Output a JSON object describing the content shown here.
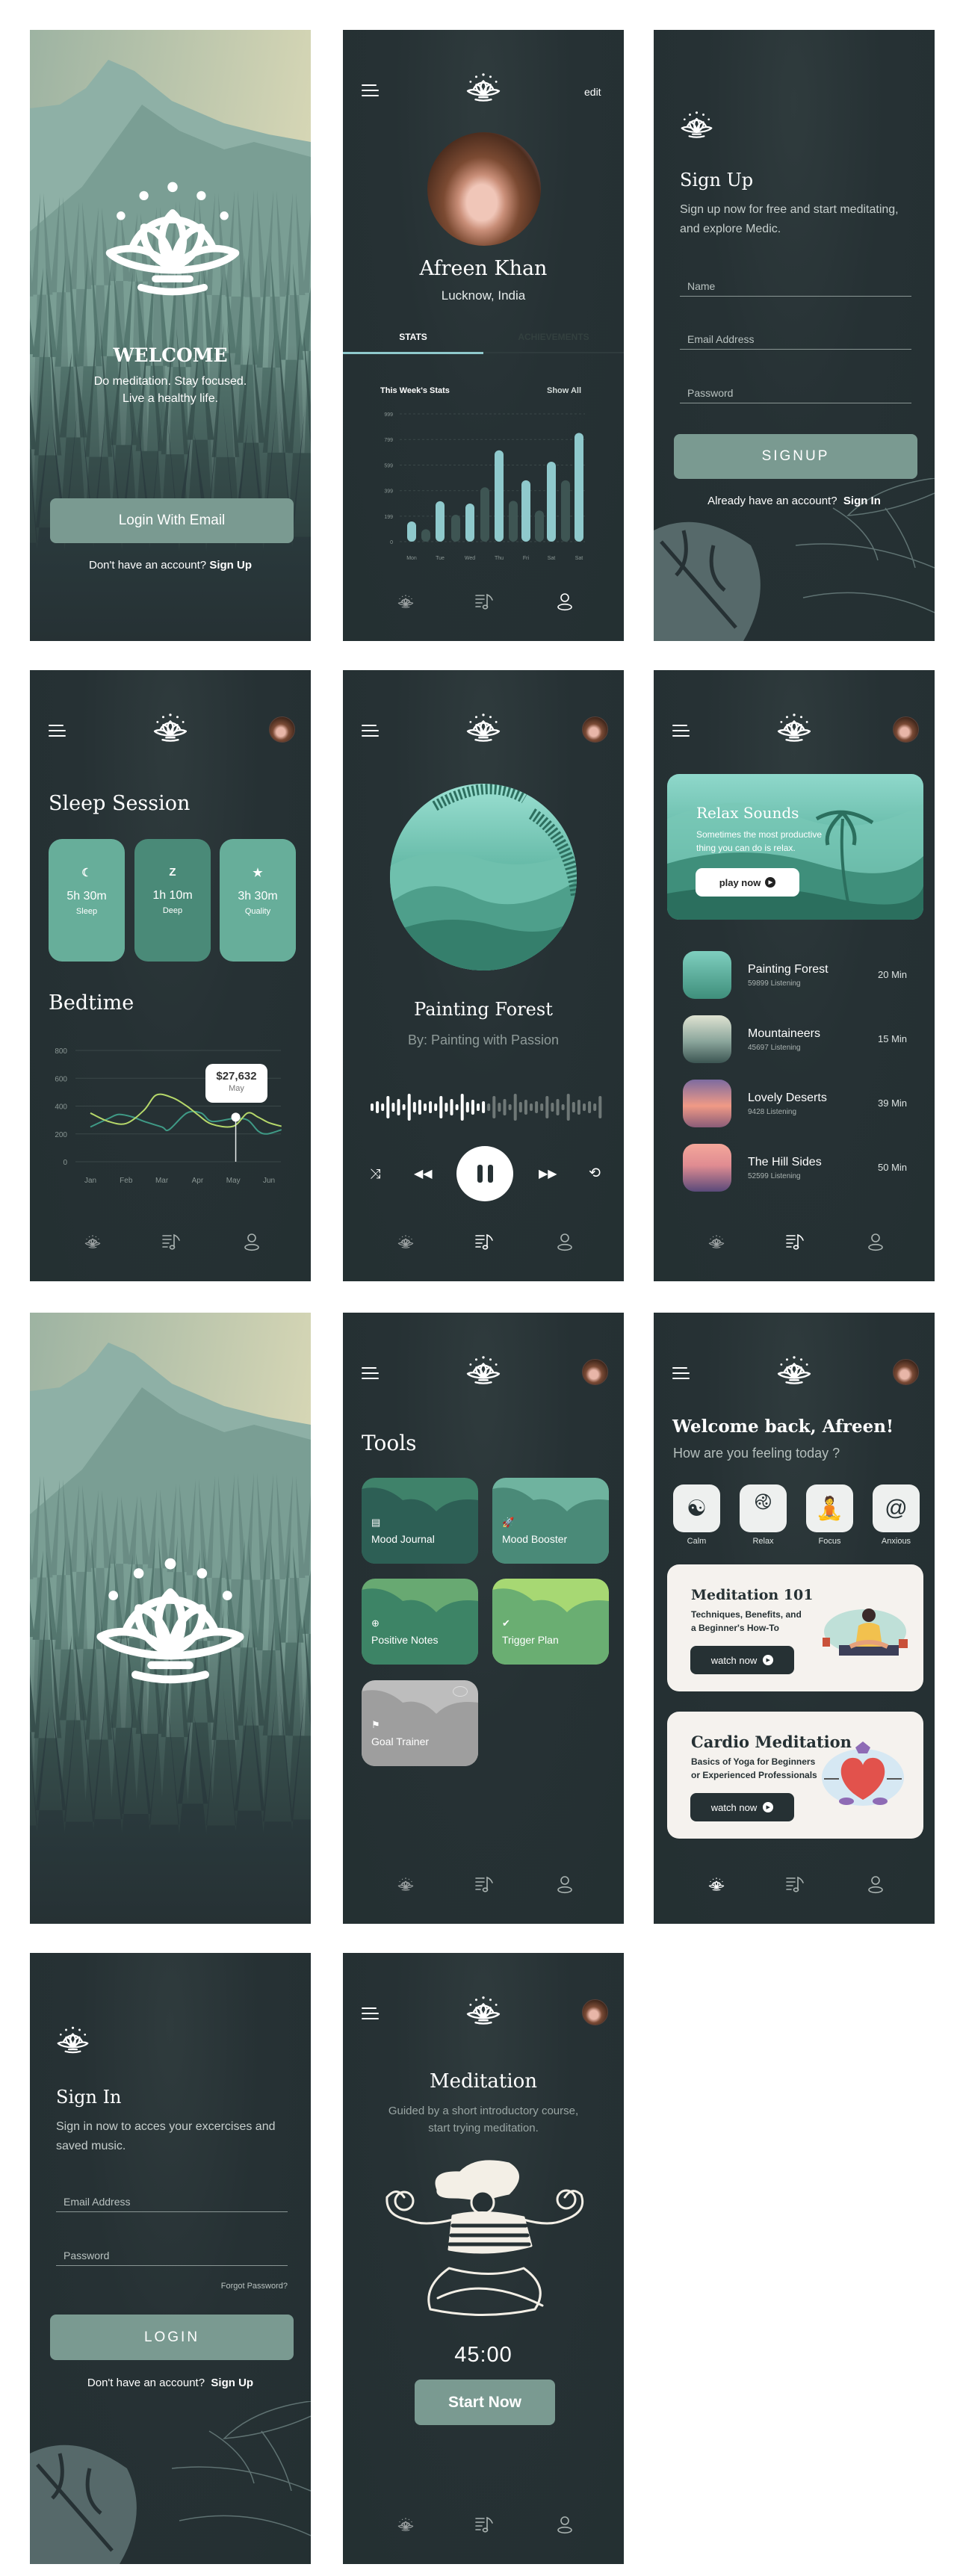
{
  "colors": {
    "background": "#263134",
    "accent_button": "#7a9a91",
    "tab_active": "#8fc9cc",
    "card_light": "#67ae9a",
    "card_dark": "#4a8a78",
    "line_yellow": "#b6d86a",
    "line_teal": "#3f9a86",
    "cream_card": "#f5f2ee"
  },
  "icons": {
    "menu": "hamburger-icon",
    "logo": "lotus-logo-icon",
    "nav": [
      "lotus-icon",
      "music-list-icon",
      "user-icon"
    ]
  },
  "welcome": {
    "title": "WELCOME",
    "subtitle_line1": "Do meditation. Stay focused.",
    "subtitle_line2": "Live a healthy life.",
    "login_button": "Login With Email",
    "no_account": "Don't have an account?",
    "sign_up_link": "Sign Up"
  },
  "profile": {
    "edit": "edit",
    "name": "Afreen Khan",
    "location": "Lucknow, India",
    "tabs": [
      "STATS",
      "ACHIEVEMENTS"
    ],
    "active_tab": "STATS",
    "stats_title": "This Week's Stats",
    "show_all": "Show All"
  },
  "signup": {
    "title": "Sign Up",
    "description": "Sign up now for free and start meditating, and explore Medic.",
    "fields": [
      "Name",
      "Email Address",
      "Password"
    ],
    "button": "SIGNUP",
    "have_account": "Already have an account?",
    "sign_in_link": "Sign In"
  },
  "sleep": {
    "title": "Sleep Session",
    "cards": [
      {
        "icon": "moon-icon",
        "glyph": "☾",
        "value": "5h 30m",
        "label": "Sleep"
      },
      {
        "icon": "z-icon",
        "glyph": "Z",
        "value": "1h 10m",
        "label": "Deep"
      },
      {
        "icon": "star-icon",
        "glyph": "★",
        "value": "3h 30m",
        "label": "Quality"
      }
    ],
    "bedtime_title": "Bedtime",
    "tooltip_value": "$27,632",
    "tooltip_label": "May"
  },
  "player": {
    "title": "Painting Forest",
    "artist": "By: Painting with Passion",
    "progress": 0.48,
    "controls": [
      "shuffle",
      "previous",
      "pause",
      "next",
      "repeat"
    ]
  },
  "relax": {
    "banner_title": "Relax Sounds",
    "banner_text_line1": "Sometimes the most productive",
    "banner_text_line2": "thing you can do is relax.",
    "play_button": "play now",
    "tracks": [
      {
        "title": "Painting Forest",
        "listeners": "59899 Listening",
        "duration": "20 Min"
      },
      {
        "title": "Mountaineers",
        "listeners": "45697 Listening",
        "duration": "15 Min"
      },
      {
        "title": "Lovely Deserts",
        "listeners": "9428  Listening",
        "duration": "39 Min"
      },
      {
        "title": "The Hill Sides",
        "listeners": "52599 Listening",
        "duration": "50 Min"
      }
    ]
  },
  "tools": {
    "title": "Tools",
    "items": [
      {
        "label": "Mood Journal",
        "icon": "journal-icon"
      },
      {
        "label": "Mood Booster",
        "icon": "rocket-icon"
      },
      {
        "label": "Positive Notes",
        "icon": "head-plus-icon"
      },
      {
        "label": "Trigger Plan",
        "icon": "badge-check-icon"
      },
      {
        "label": "Goal Trainer",
        "icon": "flag-icon",
        "locked": true
      }
    ]
  },
  "home": {
    "greeting": "Welcome back, Afreen!",
    "question": "How are you feeling today ?",
    "moods": [
      {
        "label": "Calm",
        "icon": "yin-yang-icon"
      },
      {
        "label": "Relax",
        "icon": "triskelion-icon"
      },
      {
        "label": "Focus",
        "icon": "buddha-icon"
      },
      {
        "label": "Anxious",
        "icon": "spiral-icon"
      }
    ],
    "cards": [
      {
        "title": "Meditation 101",
        "line1": "Techniques, Benefits, and",
        "line2": "a Beginner's How-To",
        "button": "watch now"
      },
      {
        "title": "Cardio Meditation",
        "line1": "Basics of Yoga for Beginners",
        "line2": "or Experienced Professionals",
        "button": "watch now"
      }
    ]
  },
  "signin": {
    "title": "Sign In",
    "description": "Sign in now to acces your excercises and saved music.",
    "fields": [
      "Email Address",
      "Password"
    ],
    "forgot": "Forgot Password?",
    "button": "LOGIN",
    "no_account": "Don't have an account?",
    "sign_up_link": "Sign Up"
  },
  "meditation": {
    "title": "Meditation",
    "description_line1": "Guided by a short introductory course,",
    "description_line2": "start trying meditation.",
    "timer": "45:00",
    "button": "Start Now"
  },
  "chart_data": [
    {
      "type": "bar",
      "title": "This Week's Stats",
      "categories": [
        "Mon",
        "Tue",
        "Wed",
        "Thu",
        "Fri",
        "Sat",
        "Sat"
      ],
      "yticks": [
        0,
        199,
        399,
        599,
        799,
        999
      ],
      "ylim": [
        0,
        999
      ],
      "grid": true,
      "series": [
        {
          "values": [
            158,
            316,
            298,
            714,
            480,
            625,
            850
          ],
          "color": "#8fc9cc"
        },
        {
          "values": [
            97,
            210,
            425,
            319,
            243,
            480
          ],
          "color": "#3e5553"
        }
      ]
    },
    {
      "type": "line",
      "title": "Bedtime",
      "categories": [
        "Jan",
        "Feb",
        "Mar",
        "Apr",
        "May",
        "Jun"
      ],
      "yticks": [
        0,
        200,
        400,
        600,
        800
      ],
      "ylim": [
        0,
        800
      ],
      "grid": true,
      "series": [
        {
          "color": "#b6d86a",
          "points": [
            [
              0,
              350
            ],
            [
              0.5,
              290
            ],
            [
              1,
              275
            ],
            [
              1.5,
              370
            ],
            [
              1.85,
              480
            ],
            [
              2.3,
              460
            ],
            [
              2.7,
              400
            ],
            [
              3,
              340
            ],
            [
              3.4,
              270
            ],
            [
              4,
              255
            ],
            [
              4.4,
              350
            ],
            [
              4.7,
              320
            ],
            [
              5,
              280
            ],
            [
              5.35,
              255
            ]
          ]
        },
        {
          "color": "#3f9a86",
          "points": [
            [
              0,
              250
            ],
            [
              0.5,
              310
            ],
            [
              0.8,
              340
            ],
            [
              1.2,
              320
            ],
            [
              1.5,
              290
            ],
            [
              2,
              250
            ],
            [
              2.2,
              230
            ],
            [
              2.7,
              350
            ],
            [
              3.1,
              350
            ],
            [
              3.4,
              290
            ],
            [
              4,
              310
            ],
            [
              4.4,
              300
            ],
            [
              4.7,
              220
            ],
            [
              4.95,
              200
            ],
            [
              5.35,
              230
            ]
          ]
        }
      ],
      "highlight": {
        "x": 4.07,
        "y": 320,
        "label": "$27,632",
        "sublabel": "May"
      }
    }
  ]
}
